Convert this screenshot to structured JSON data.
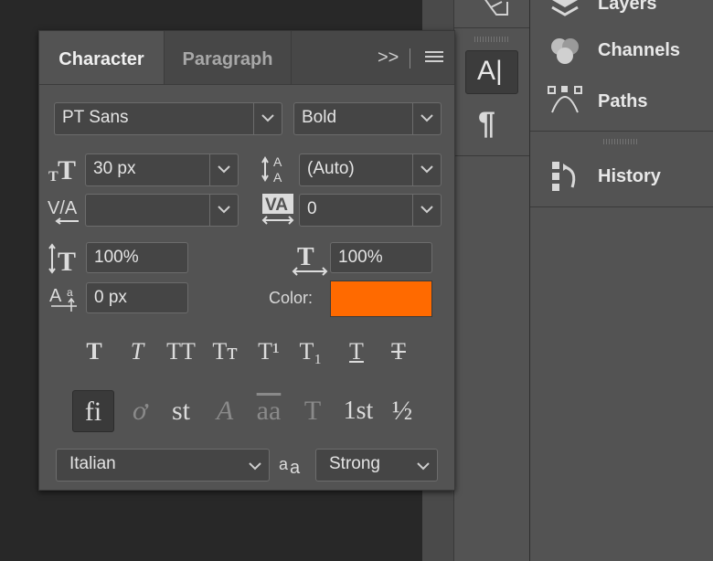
{
  "panel": {
    "tabs": [
      {
        "label": "Character"
      },
      {
        "label": "Paragraph"
      }
    ],
    "font_family": "PT Sans",
    "font_style": "Bold",
    "font_size": "30 px",
    "leading": "(Auto)",
    "kerning": "",
    "tracking": "0",
    "vertical_scale": "100%",
    "horizontal_scale": "100%",
    "baseline_shift": "0 px",
    "color_label": "Color:",
    "color_value": "#FF6A00",
    "language": "Italian",
    "antialias": "Strong",
    "type_style_buttons": [
      "T",
      "T",
      "TT",
      "Tт",
      "T¹",
      "T₁",
      "T",
      "T"
    ],
    "opentype_buttons": [
      "fi",
      "ơ",
      "st",
      "A",
      "aa",
      "T",
      "1st",
      "½"
    ],
    "expand_glyph": ">>"
  },
  "icon_strip": {
    "tools": [
      "character-tool",
      "paragraph-tool"
    ],
    "char_label": "A|",
    "para_label": "¶"
  },
  "dock": {
    "items": [
      {
        "label": "Layers"
      },
      {
        "label": "Channels"
      },
      {
        "label": "Paths"
      },
      {
        "label": "History"
      }
    ]
  }
}
